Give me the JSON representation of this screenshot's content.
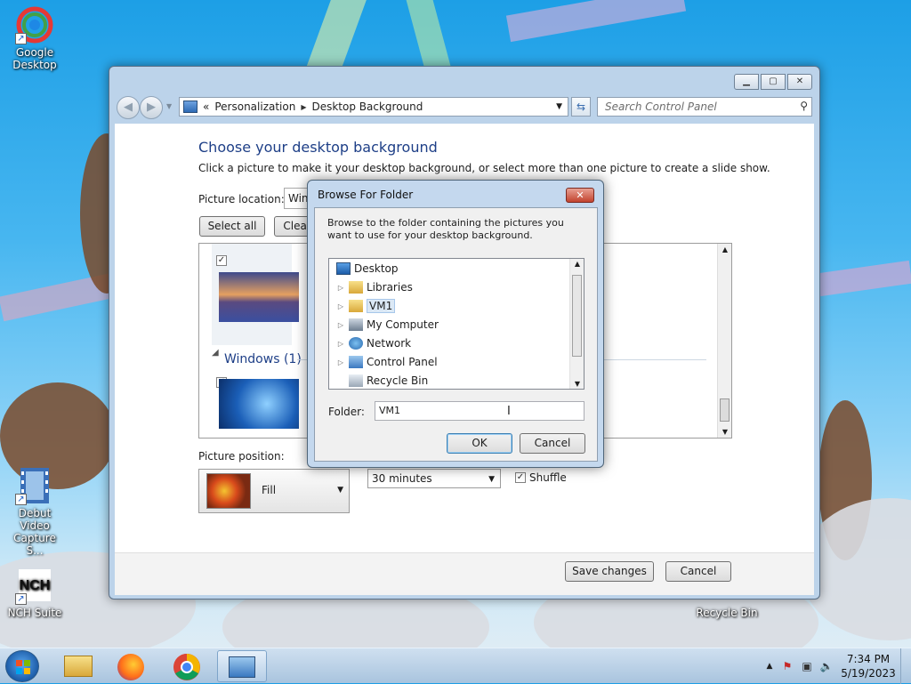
{
  "desktop": {
    "icons": [
      {
        "label": "Google Desktop"
      },
      {
        "label": "Debut Video Capture S..."
      },
      {
        "label": "NCH Suite"
      },
      {
        "label": "Recycle Bin"
      }
    ]
  },
  "window": {
    "address": {
      "prefix": "«",
      "crumbs": [
        "Personalization",
        "Desktop Background"
      ]
    },
    "search_placeholder": "Search Control Panel",
    "heading": "Choose your desktop background",
    "subheading": "Click a picture to make it your desktop background, or select more than one picture to create a slide show.",
    "picture_location_label": "Picture location:",
    "picture_location_value": "Windows Desktop Backgrounds",
    "select_all_label": "Select all",
    "clear_all_label": "Clear all",
    "group_windows_label": "Windows (1)",
    "picture_position_label": "Picture position:",
    "picture_position_value": "Fill",
    "interval_value": "30 minutes",
    "shuffle_label": "Shuffle",
    "save_label": "Save changes",
    "cancel_label": "Cancel"
  },
  "dialog": {
    "title": "Browse For Folder",
    "description": "Browse to the folder containing the pictures you want to use for your desktop background.",
    "tree_items": [
      {
        "label": "Desktop",
        "icon": "desktop-icon"
      },
      {
        "label": "Libraries",
        "icon": "libraries-icon"
      },
      {
        "label": "VM1",
        "icon": "user-folder-icon"
      },
      {
        "label": "My Computer",
        "icon": "computer-icon"
      },
      {
        "label": "Network",
        "icon": "network-icon"
      },
      {
        "label": "Control Panel",
        "icon": "control-panel-icon"
      },
      {
        "label": "Recycle Bin",
        "icon": "recycle-bin-icon"
      }
    ],
    "folder_label": "Folder:",
    "folder_value": "VM1",
    "ok_label": "OK",
    "cancel_label": "Cancel"
  },
  "taskbar": {
    "apps": [
      "file-explorer-icon",
      "firefox-icon",
      "chrome-icon",
      "control-panel-icon"
    ],
    "time": "7:34 PM",
    "date": "5/19/2023"
  }
}
